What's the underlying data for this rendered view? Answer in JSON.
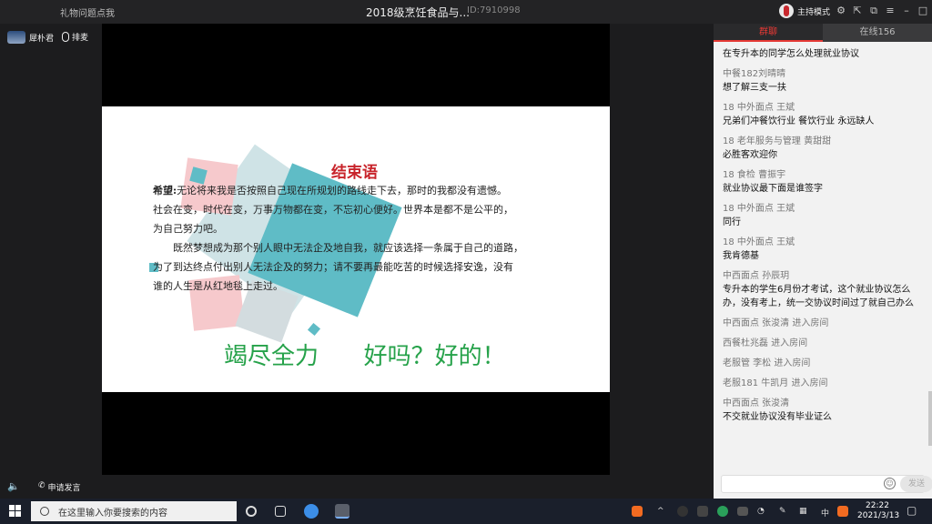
{
  "titlebar": {
    "left_link": "礼物问题点我",
    "title": "2018级烹饪食品与...",
    "room_id": "ID:7910998",
    "host_mode": "主持模式",
    "window_icons": [
      "settings-icon",
      "popout-icon",
      "restore-icon",
      "menu-icon",
      "minimize-icon",
      "maximize-icon",
      "close-icon"
    ]
  },
  "left": {
    "presenter_name": "犀朴君",
    "mic_queue_label": "排麦"
  },
  "slide": {
    "title": "结束语",
    "hope_label": "希望:",
    "para1": "无论将来我是否按照自己现在所规划的路线走下去，那时的我都没有遗憾。",
    "para1b": "社会在变，时代在变，万事万物都在变，不忘初心便好。世界本是都不是公平的，",
    "para1c": "为自己努力吧。",
    "para2": "既然梦想成为那个别人眼中无法企及地自我，就应该选择一条属于自己的道路，",
    "para2b": "为了到达终点付出别人无法企及的努力；请不要再最能吃苦的时候选择安逸，没有",
    "para2c": "谁的人生是从红地毯上走过。",
    "footer": "竭尽全力      好吗？好的！"
  },
  "chat": {
    "tab_group": "群聊",
    "tab_online": "在线156",
    "messages": [
      {
        "sender": "",
        "text": "在专升本的同学怎么处理就业协议",
        "system": ""
      },
      {
        "sender": "中餐182刘晴晴",
        "text": "想了解三支一扶",
        "system": ""
      },
      {
        "sender": "18   中外面点  王斌",
        "text": "兄弟们冲餐饮行业   餐饮行业 永远缺人",
        "system": ""
      },
      {
        "sender": "18  老年服务与管理 黄甜甜",
        "text": "必胜客欢迎你",
        "system": ""
      },
      {
        "sender": "18 食检  曹振宇",
        "text": "就业协议最下面是谁签字",
        "system": ""
      },
      {
        "sender": "18    中外面点  王斌",
        "text": "同行",
        "system": ""
      },
      {
        "sender": "18    中外面点  王斌",
        "text": "我肯德基",
        "system": ""
      },
      {
        "sender": "中西面点    孙辰玥",
        "text": "专升本的学生6月份才考试，这个就业协议怎么办，没有考上，统一交协议时间过了就自己办么",
        "system": ""
      },
      {
        "sender": "",
        "text": "",
        "system": "中西面点    张浚清 进入房间"
      },
      {
        "sender": "",
        "text": "",
        "system": "西餐杜兆磊 进入房间"
      },
      {
        "sender": "",
        "text": "",
        "system": "老服管 李松 进入房间"
      },
      {
        "sender": "",
        "text": "",
        "system": "老服181  牛凯月 进入房间"
      },
      {
        "sender": "中西面点    张浚清",
        "text": "不交就业协议没有毕业证么",
        "system": ""
      }
    ],
    "send_label": "发送"
  },
  "controls": {
    "apply_label": "申请发言"
  },
  "taskbar": {
    "search_placeholder": "在这里输入你要搜索的内容",
    "ime_label": "中",
    "time": "22:22",
    "date": "2021/3/13"
  }
}
